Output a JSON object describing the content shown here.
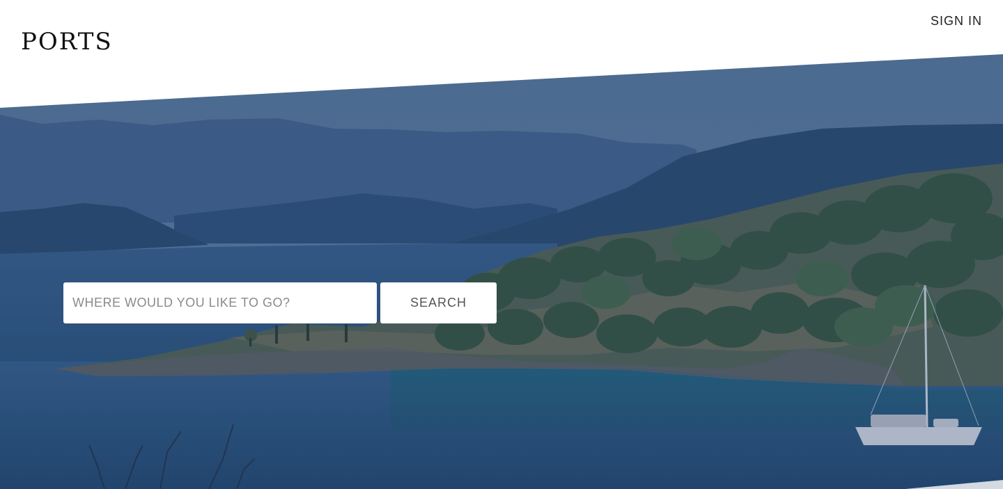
{
  "header": {
    "logo": "PORTS",
    "sign_in_label": "SIGN IN"
  },
  "hero": {
    "image": "coastal-bay-with-olive-grove-and-sailboat",
    "overlay_color": "#143466"
  },
  "search": {
    "placeholder": "WHERE WOULD YOU LIKE TO GO?",
    "value": "",
    "button_label": "SEARCH"
  }
}
